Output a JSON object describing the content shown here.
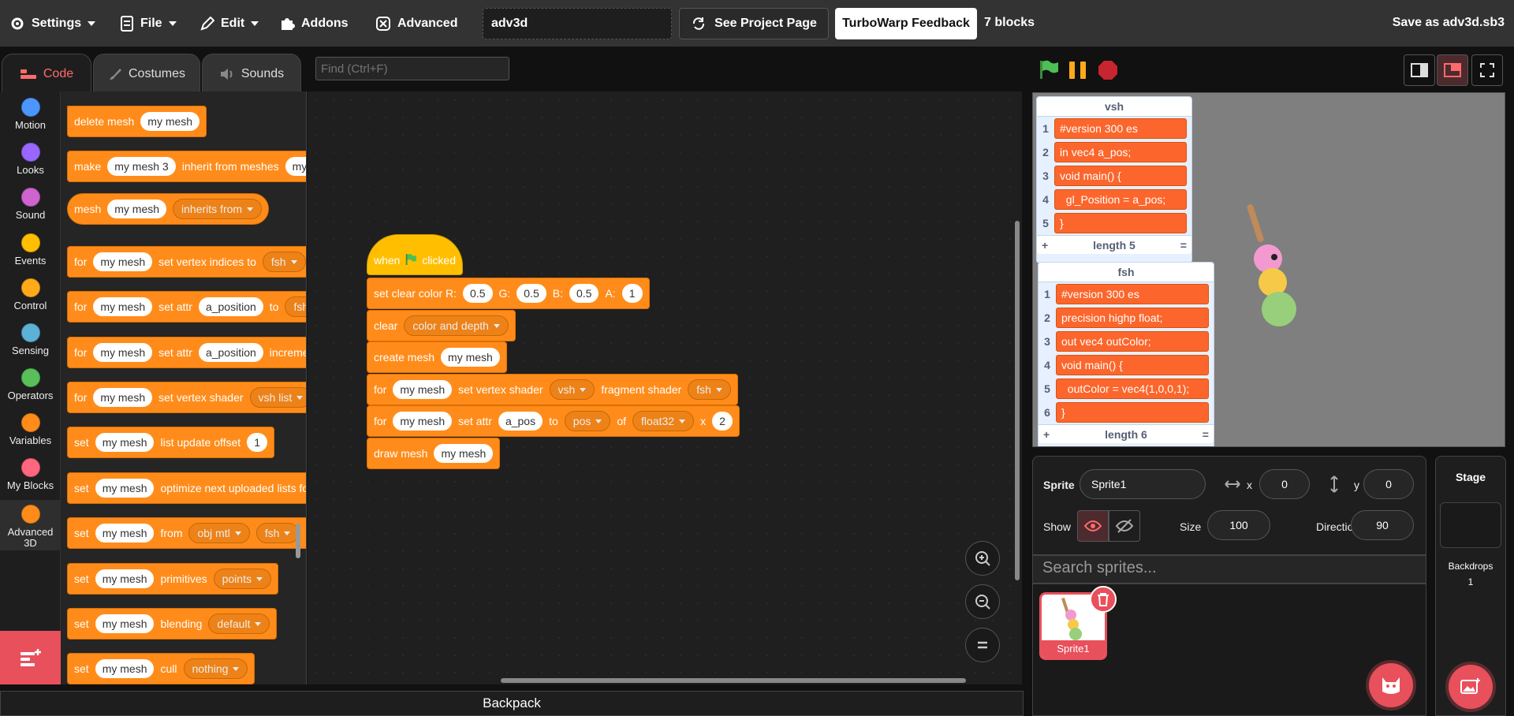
{
  "menubar": {
    "settings": "Settings",
    "file": "File",
    "edit": "Edit",
    "addons": "Addons",
    "advanced": "Advanced",
    "project_title": "adv3d",
    "see_project": "See Project Page",
    "feedback": "TurboWarp Feedback",
    "block_count": "7 blocks",
    "save_as": "Save as adv3d.sb3"
  },
  "tabs": {
    "code": "Code",
    "costumes": "Costumes",
    "sounds": "Sounds"
  },
  "find_placeholder": "Find (Ctrl+F)",
  "categories": [
    {
      "label": "Motion",
      "color": "#4c97ff"
    },
    {
      "label": "Looks",
      "color": "#9966ff"
    },
    {
      "label": "Sound",
      "color": "#cf63cf"
    },
    {
      "label": "Events",
      "color": "#ffbf00"
    },
    {
      "label": "Control",
      "color": "#ffab19"
    },
    {
      "label": "Sensing",
      "color": "#5cb1d6"
    },
    {
      "label": "Operators",
      "color": "#59c059"
    },
    {
      "label": "Variables",
      "color": "#ff8c1a"
    },
    {
      "label": "My Blocks",
      "color": "#ff6680"
    },
    {
      "label": "Advanced 3D",
      "color": "#ff8c1a"
    }
  ],
  "palette": {
    "delete_mesh": {
      "t1": "delete mesh",
      "v1": "my mesh"
    },
    "make_inherit": {
      "t1": "make",
      "v1": "my mesh 3",
      "t2": "inherit from meshes",
      "v2": "my m"
    },
    "mesh_inherits": {
      "t1": "mesh",
      "v1": "my mesh",
      "d1": "inherits from"
    },
    "vertex_indices": {
      "t1": "for",
      "v1": "my mesh",
      "t2": "set vertex indices to",
      "d1": "fsh"
    },
    "set_attr": {
      "t1": "for",
      "v1": "my mesh",
      "t2": "set attr",
      "v2": "a_position",
      "t3": "to",
      "t4": "fsh"
    },
    "set_attr_inc": {
      "t1": "for",
      "v1": "my mesh",
      "t2": "set attr",
      "v2": "a_position",
      "t3": "increme"
    },
    "vertex_shader": {
      "t1": "for",
      "v1": "my mesh",
      "t2": "set vertex shader",
      "d1": "vsh list"
    },
    "list_offset": {
      "t1": "set",
      "v1": "my mesh",
      "t2": "list update offset",
      "v2": "1"
    },
    "optimize": {
      "t1": "set",
      "v1": "my mesh",
      "t2": "optimize next uploaded lists fo"
    },
    "from_obj": {
      "t1": "set",
      "v1": "my mesh",
      "t2": "from",
      "d1": "obj mtl",
      "d2": "fsh"
    },
    "primitives": {
      "t1": "set",
      "v1": "my mesh",
      "t2": "primitives",
      "d1": "points"
    },
    "blending": {
      "t1": "set",
      "v1": "my mesh",
      "t2": "blending",
      "d1": "default"
    },
    "cull": {
      "t1": "set",
      "v1": "my mesh",
      "t2": "cull",
      "d1": "nothing"
    }
  },
  "script": {
    "hat": {
      "t1": "when",
      "t2": "clicked"
    },
    "clear_color": {
      "t1": "set clear color R:",
      "r": "0.5",
      "tg": "G:",
      "g": "0.5",
      "tb": "B:",
      "b": "0.5",
      "ta": "A:",
      "a": "1"
    },
    "clear": {
      "t1": "clear",
      "d1": "color and depth"
    },
    "create": {
      "t1": "create mesh",
      "v1": "my mesh"
    },
    "shaders": {
      "t1": "for",
      "v1": "my mesh",
      "t2": "set vertex shader",
      "d1": "vsh",
      "t3": "fragment shader",
      "d2": "fsh"
    },
    "attr": {
      "t1": "for",
      "v1": "my mesh",
      "t2": "set attr",
      "v2": "a_pos",
      "t3": "to",
      "d1": "pos",
      "t4": "of",
      "d2": "float32",
      "t5": "x",
      "v3": "2"
    },
    "draw": {
      "t1": "draw mesh",
      "v1": "my mesh"
    }
  },
  "backpack": "Backpack",
  "lists": {
    "vsh": {
      "title": "vsh",
      "items": [
        "#version 300 es",
        "in vec4 a_pos;",
        "void main() {",
        "  gl_Position = a_pos;",
        "}"
      ],
      "length_label": "length 5",
      "add": "+",
      "eq": "="
    },
    "fsh": {
      "title": "fsh",
      "items": [
        "#version 300 es",
        "precision highp float;",
        "out vec4 outColor;",
        "void main() {",
        "  outColor = vec4(1,0,0,1);",
        "}"
      ],
      "length_label": "length 6",
      "add": "+",
      "eq": "="
    }
  },
  "sprite_info": {
    "sprite_label": "Sprite",
    "sprite_name": "Sprite1",
    "x_label": "x",
    "x": "0",
    "y_label": "y",
    "y": "0",
    "show_label": "Show",
    "size_label": "Size",
    "size": "100",
    "direction_label": "Direction",
    "direction": "90"
  },
  "search_sprites": "Search sprites...",
  "sprites": [
    {
      "name": "Sprite1"
    }
  ],
  "stage_pane": {
    "title": "Stage",
    "backdrops_label": "Backdrops",
    "backdrops": "1"
  },
  "colors": {
    "accent": "#ff6b6b",
    "block": "#ff8c1a",
    "event": "#ffbf00",
    "list_item": "#fc662c"
  }
}
